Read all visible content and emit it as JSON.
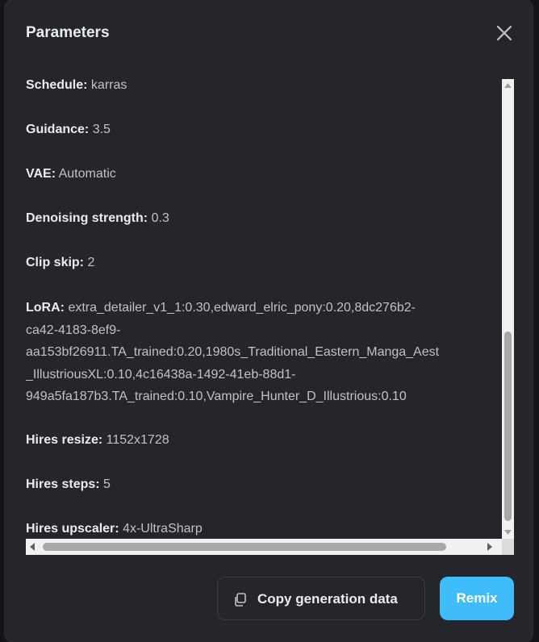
{
  "dialog": {
    "title": "Parameters",
    "close_icon": "close-icon"
  },
  "params": [
    {
      "key": "Schedule:",
      "value": "karras"
    },
    {
      "key": "Guidance:",
      "value": "3.5"
    },
    {
      "key": "VAE:",
      "value": "Automatic"
    },
    {
      "key": "Denoising strength:",
      "value": "0.3"
    },
    {
      "key": "Clip skip:",
      "value": "2"
    }
  ],
  "lora": {
    "key": "LoRA:",
    "lines": [
      "extra_detailer_v1_1:0.30,edward_elric_pony:0.20,8dc276b2-",
      "ca42-4183-8ef9-",
      "aa153bf26911.TA_trained:0.20,1980s_Traditional_Eastern_Manga_Aest",
      "_IllustriousXL:0.10,4c16438a-1492-41eb-88d1-",
      "949a5fa187b3.TA_trained:0.10,Vampire_Hunter_D_Illustrious:0.10"
    ]
  },
  "params_after": [
    {
      "key": "Hires resize:",
      "value": "1152x1728"
    },
    {
      "key": "Hires steps:",
      "value": "5"
    },
    {
      "key": "Hires upscaler:",
      "value": "4x-UltraSharp"
    }
  ],
  "footer": {
    "copy_label": "Copy generation data",
    "copy_icon": "copy-icon",
    "remix_label": "Remix"
  },
  "colors": {
    "modal_bg": "#25262b",
    "accent": "#3ebdfa",
    "text": "#c1c2c5",
    "heading": "#e9ecef"
  }
}
